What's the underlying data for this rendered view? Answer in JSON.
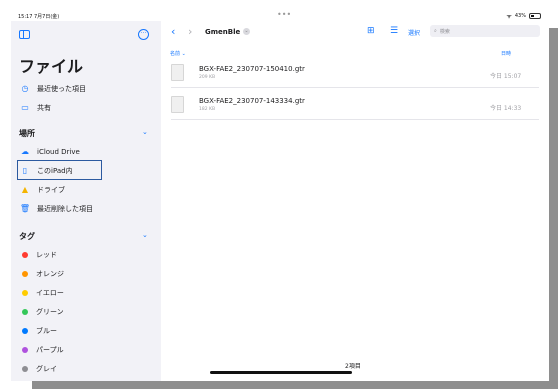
{
  "status": {
    "time": "15:17  7月7日(金)",
    "battery": "43%",
    "battery_level": 0.43
  },
  "sidebar": {
    "title": "ファイル",
    "recents": "最近使った項目",
    "shared": "共有",
    "locations_header": "場所",
    "locations": [
      {
        "label": "iCloud Drive",
        "icon": "cloud-icon"
      },
      {
        "label": "このiPad内",
        "icon": "ipad-icon"
      },
      {
        "label": "ドライブ",
        "icon": "google-drive-icon"
      },
      {
        "label": "最近削除した項目",
        "icon": "trash-icon"
      }
    ],
    "tags_header": "タグ",
    "tags": [
      {
        "label": "レッド",
        "color": "#ff3b30"
      },
      {
        "label": "オレンジ",
        "color": "#ff9500"
      },
      {
        "label": "イエロー",
        "color": "#ffcc00"
      },
      {
        "label": "グリーン",
        "color": "#34c759"
      },
      {
        "label": "ブルー",
        "color": "#007aff"
      },
      {
        "label": "パープル",
        "color": "#af52de"
      },
      {
        "label": "グレイ",
        "color": "#8e8e93"
      }
    ]
  },
  "main": {
    "folder": "GmenBle",
    "select_label": "選択",
    "search_placeholder": "検索",
    "col_name": "名前",
    "col_date": "日時",
    "files": [
      {
        "name": "BGX-FAE2_230707-150410.gtr",
        "size": "209 KB",
        "date": "今日 15:07"
      },
      {
        "name": "BGX-FAE2_230707-143334.gtr",
        "size": "182 KB",
        "date": "今日 14:33"
      }
    ],
    "count": "2項目"
  },
  "colors": {
    "accent": "#1677ff",
    "highlight_box": "#2c5aa0"
  }
}
